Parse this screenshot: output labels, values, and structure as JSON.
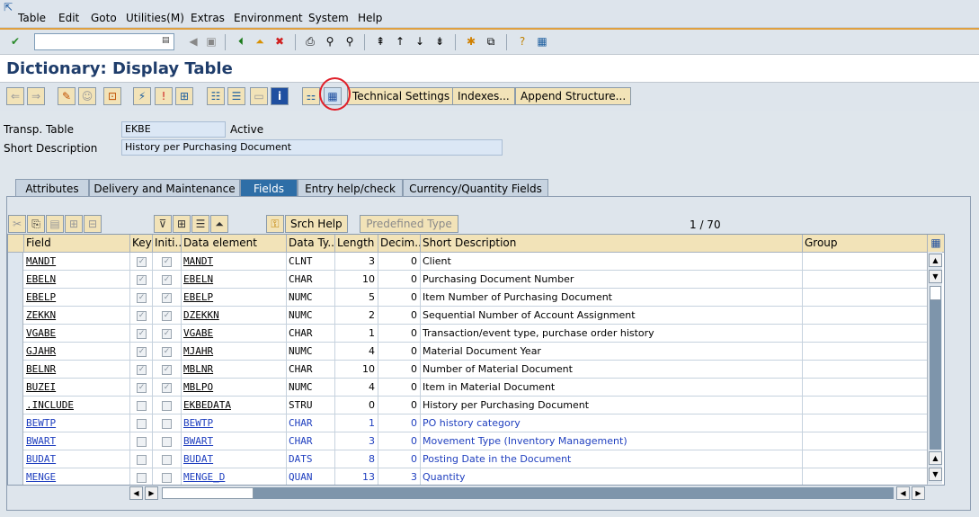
{
  "menu": [
    "Table",
    "Edit",
    "Goto",
    "Utilities(M)",
    "Extras",
    "Environment",
    "System",
    "Help"
  ],
  "title": "Dictionary: Display Table",
  "command_field": {
    "value": "",
    "placeholder": ""
  },
  "app_toolbar": {
    "technical_settings": "Technical Settings",
    "indexes": "Indexes...",
    "append_structure": "Append Structure..."
  },
  "header": {
    "transp_table_label": "Transp. Table",
    "transp_table_value": "EKBE",
    "status": "Active",
    "short_desc_label": "Short Description",
    "short_desc_value": "History per Purchasing Document"
  },
  "tabs": [
    "Attributes",
    "Delivery and Maintenance",
    "Fields",
    "Entry help/check",
    "Currency/Quantity Fields"
  ],
  "active_tab": "Fields",
  "table_toolbar": {
    "srch_help": "Srch Help",
    "predefined_type": "Predefined Type",
    "pager": "1  /  70"
  },
  "columns": [
    "Field",
    "Key",
    "Initi...",
    "Data element",
    "Data Ty...",
    "Length",
    "Decim...",
    "Short Description",
    "Group"
  ],
  "rows": [
    {
      "field": "MANDT",
      "key": true,
      "init": true,
      "elem": "MANDT",
      "type": "CLNT",
      "len": "3",
      "dec": "0",
      "desc": "Client",
      "blue": false
    },
    {
      "field": "EBELN",
      "key": true,
      "init": true,
      "elem": "EBELN",
      "type": "CHAR",
      "len": "10",
      "dec": "0",
      "desc": "Purchasing Document Number",
      "blue": false
    },
    {
      "field": "EBELP",
      "key": true,
      "init": true,
      "elem": "EBELP",
      "type": "NUMC",
      "len": "5",
      "dec": "0",
      "desc": "Item Number of Purchasing Document",
      "blue": false
    },
    {
      "field": "ZEKKN",
      "key": true,
      "init": true,
      "elem": "DZEKKN",
      "type": "NUMC",
      "len": "2",
      "dec": "0",
      "desc": "Sequential Number of Account Assignment",
      "blue": false
    },
    {
      "field": "VGABE",
      "key": true,
      "init": true,
      "elem": "VGABE",
      "type": "CHAR",
      "len": "1",
      "dec": "0",
      "desc": "Transaction/event type, purchase order history",
      "blue": false
    },
    {
      "field": "GJAHR",
      "key": true,
      "init": true,
      "elem": "MJAHR",
      "type": "NUMC",
      "len": "4",
      "dec": "0",
      "desc": "Material Document Year",
      "blue": false
    },
    {
      "field": "BELNR",
      "key": true,
      "init": true,
      "elem": "MBLNR",
      "type": "CHAR",
      "len": "10",
      "dec": "0",
      "desc": "Number of Material Document",
      "blue": false
    },
    {
      "field": "BUZEI",
      "key": true,
      "init": true,
      "elem": "MBLPO",
      "type": "NUMC",
      "len": "4",
      "dec": "0",
      "desc": "Item in Material Document",
      "blue": false
    },
    {
      "field": ".INCLUDE",
      "key": false,
      "init": false,
      "elem": "EKBEDATA",
      "type": "STRU",
      "len": "0",
      "dec": "0",
      "desc": "History per Purchasing Document",
      "blue": false
    },
    {
      "field": "BEWTP",
      "key": false,
      "init": false,
      "elem": "BEWTP",
      "type": "CHAR",
      "len": "1",
      "dec": "0",
      "desc": "PO history category",
      "blue": true
    },
    {
      "field": "BWART",
      "key": false,
      "init": false,
      "elem": "BWART",
      "type": "CHAR",
      "len": "3",
      "dec": "0",
      "desc": "Movement Type (Inventory Management)",
      "blue": true
    },
    {
      "field": "BUDAT",
      "key": false,
      "init": false,
      "elem": "BUDAT",
      "type": "DATS",
      "len": "8",
      "dec": "0",
      "desc": "Posting Date in the Document",
      "blue": true
    },
    {
      "field": "MENGE",
      "key": false,
      "init": false,
      "elem": "MENGE_D",
      "type": "QUAN",
      "len": "13",
      "dec": "3",
      "desc": "Quantity",
      "blue": true
    }
  ]
}
